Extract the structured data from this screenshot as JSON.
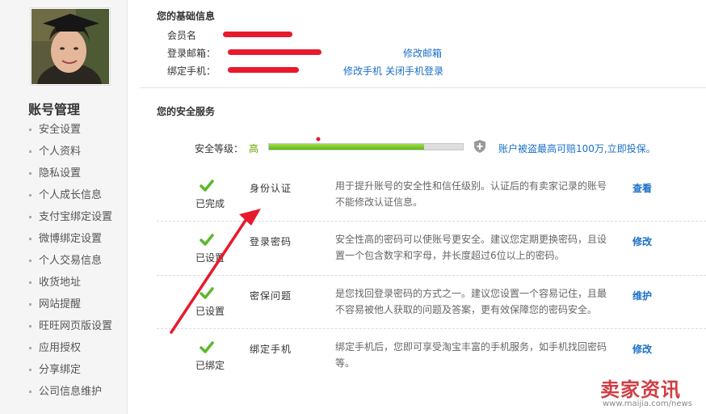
{
  "sidebar": {
    "title": "账号管理",
    "items": [
      {
        "label": "安全设置"
      },
      {
        "label": "个人资料"
      },
      {
        "label": "隐私设置"
      },
      {
        "label": "个人成长信息"
      },
      {
        "label": "支付宝绑定设置"
      },
      {
        "label": "微博绑定设置"
      },
      {
        "label": "个人交易信息"
      },
      {
        "label": "收货地址"
      },
      {
        "label": "网站提醒"
      },
      {
        "label": "旺旺网页版设置"
      },
      {
        "label": "应用授权"
      },
      {
        "label": "分享绑定"
      },
      {
        "label": "公司信息维护"
      }
    ]
  },
  "basic_info": {
    "title": "您的基础信息",
    "member_label": "会员名",
    "email_label": "登录邮箱：",
    "email_action": "修改邮箱",
    "phone_label": "绑定手机：",
    "phone_action_modify": "修改手机",
    "phone_action_close": "关闭手机登录"
  },
  "security": {
    "title": "您的安全服务",
    "level_label": "安全等级：",
    "level_value": "高",
    "level_fraction": 0.8,
    "insurance_text": "账户被盗最高可赔100万,立即投保。",
    "services": [
      {
        "status": "已完成",
        "name": "身份认证",
        "desc": "用于提升账号的安全性和信任级别。认证后的有卖家记录的账号不能修改认证信息。",
        "action": "查看"
      },
      {
        "status": "已设置",
        "name": "登录密码",
        "desc": "安全性高的密码可以使账号更安全。建议您定期更换密码，且设置一个包含数字和字母，并长度超过6位以上的密码。",
        "action": "修改"
      },
      {
        "status": "已设置",
        "name": "密保问题",
        "desc": "是您找回登录密码的方式之一。建议您设置一个容易记住，且最不容易被他人获取的问题及答案，更有效保障您的密码安全。",
        "action": "维护"
      },
      {
        "status": "已绑定",
        "name": "绑定手机",
        "desc": "绑定手机后，您即可享受淘宝丰富的手机服务，如手机找回密码等。",
        "action": "修改"
      }
    ]
  },
  "watermark": {
    "brand": "卖家资讯",
    "url": "www.maijia.com/news"
  },
  "colors": {
    "link": "#1a6fc7",
    "success": "#5cb82d",
    "annotation": "#e8192c",
    "bar_fill": "#7cc52a"
  }
}
